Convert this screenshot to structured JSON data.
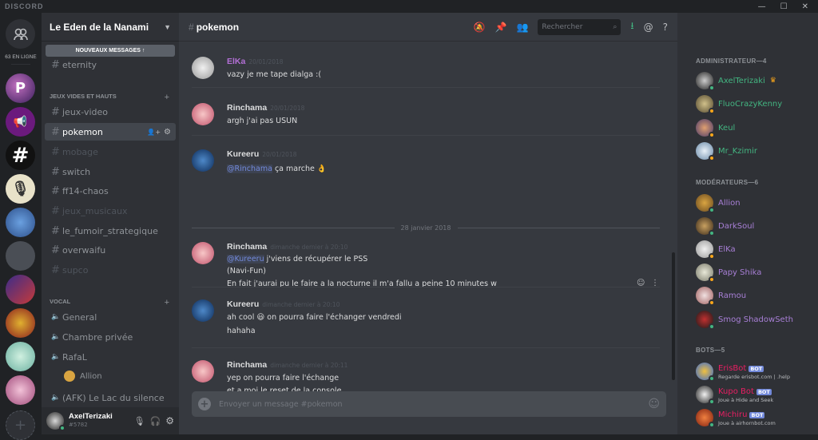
{
  "app": {
    "brand": "DISCORD"
  },
  "servers": {
    "online_label": "63 EN LIGNE",
    "add_label": "+"
  },
  "guild": {
    "name": "Le Eden de la Nanami",
    "new_messages": "NOUVEAUX MESSAGES ↑"
  },
  "channels": {
    "top": [
      {
        "name": "eternity"
      }
    ],
    "cat_jeux": "JEUX VIDES ET HAUTS",
    "text": [
      {
        "name": "jeux-video"
      },
      {
        "name": "pokemon"
      },
      {
        "name": "mobage"
      },
      {
        "name": "switch"
      },
      {
        "name": "ff14-chaos"
      },
      {
        "name": "jeux_musicaux"
      },
      {
        "name": "le_fumoir_strategique"
      },
      {
        "name": "overwaifu"
      },
      {
        "name": "supco"
      }
    ],
    "cat_vocal": "VOCAL",
    "voice": [
      {
        "name": "General"
      },
      {
        "name": "Chambre privée"
      },
      {
        "name": "RafaL"
      },
      {
        "name": "(AFK) Le Lac du silence"
      }
    ],
    "voice_user": "Allion"
  },
  "user": {
    "name": "AxelTerizaki",
    "tag": "#5782"
  },
  "channel": {
    "title": "pokemon",
    "search_placeholder": "Rechercher"
  },
  "messages": [
    {
      "author": "ElKa",
      "timestamp": "20/01/2018",
      "lines": [
        "vazy je me tape dialga :("
      ]
    },
    {
      "author": "Rinchama",
      "timestamp": "20/01/2018",
      "lines": [
        "argh j'ai pas USUN"
      ]
    },
    {
      "author": "Kureeru",
      "timestamp": "20/01/2018",
      "mention": "@Rinchama",
      "lines": [
        "ça marche 👌"
      ]
    },
    {
      "author": "Rinchama",
      "timestamp": "dimanche dernier à 20:10",
      "mention": "@Kureeru",
      "lines": [
        "j'viens de récupérer le PSS",
        "(Navi-Fun)",
        "En fait j'aurai pu le faire a la nocturne il m'a fallu a peine 10 minutes w"
      ]
    },
    {
      "author": "Kureeru",
      "timestamp": "dimanche dernier à 20:10",
      "lines": [
        "ah cool 😃 on pourra faire l'échanger vendredi",
        "hahaha"
      ]
    },
    {
      "author": "Rinchama",
      "timestamp": "dimanche dernier à 20:11",
      "lines": [
        "yep on pourra faire l'échange",
        "et a moi le reset de la console"
      ]
    }
  ],
  "date_divider": "28 janvier 2018",
  "composer": {
    "placeholder": "Envoyer un message #pokemon"
  },
  "members": {
    "admin_label": "ADMINISTRATEUR—4",
    "admins": [
      {
        "name": "AxelTerizaki",
        "crown": "♛"
      },
      {
        "name": "FluoCrazyKenny"
      },
      {
        "name": "Keul"
      },
      {
        "name": "Mr_Kzimir"
      }
    ],
    "mod_label": "MODÉRATEURS—6",
    "mods": [
      {
        "name": "Allion"
      },
      {
        "name": "DarkSoul"
      },
      {
        "name": "ElKa"
      },
      {
        "name": "Papy Shika"
      },
      {
        "name": "Ramou"
      },
      {
        "name": "Smog ShadowSeth"
      }
    ],
    "bot_label": "BOTS—5",
    "bots": [
      {
        "name": "ErisBot",
        "badge": "BOT",
        "activity": "Regarde erisbot.com | .help"
      },
      {
        "name": "Kupo Bot",
        "badge": "BOT",
        "activity": "Joue à Hide and Seek"
      },
      {
        "name": "Michiru",
        "badge": "BOT",
        "activity": "Joue à airhornbot.com"
      }
    ]
  },
  "colors": {
    "elka": "#b36fd6",
    "rinchama": "#dcddde",
    "kureeru": "#dcddde",
    "admin": "#43b581",
    "mod": "#a87fd6",
    "bot": "#e91e63"
  }
}
